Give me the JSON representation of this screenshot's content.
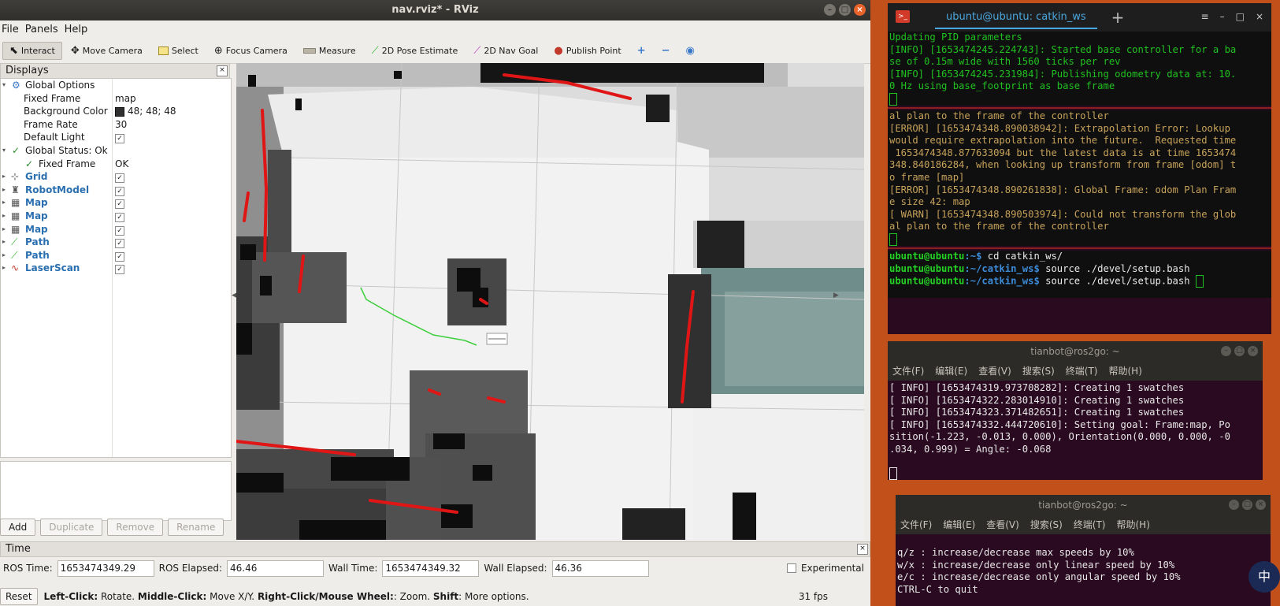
{
  "rviz": {
    "title": "nav.rviz* - RViz",
    "menus": [
      "File",
      "Panels",
      "Help"
    ],
    "tools": [
      {
        "label": "Interact",
        "icon": "cursor-icon",
        "active": true
      },
      {
        "label": "Move Camera",
        "icon": "move-camera-icon"
      },
      {
        "label": "Select",
        "icon": "select-icon"
      },
      {
        "label": "Focus Camera",
        "icon": "focus-camera-icon"
      },
      {
        "label": "Measure",
        "icon": "ruler-icon"
      },
      {
        "label": "2D Pose Estimate",
        "icon": "pose-arrow-green-icon"
      },
      {
        "label": "2D Nav Goal",
        "icon": "nav-goal-arrow-magenta-icon"
      },
      {
        "label": "Publish Point",
        "icon": "map-pin-icon"
      }
    ],
    "displays": {
      "title": "Displays",
      "global_options": "Global Options",
      "fixed_frame_label": "Fixed Frame",
      "fixed_frame_value": "map",
      "background_color_label": "Background Color",
      "background_color_value": "48; 48; 48",
      "frame_rate_label": "Frame Rate",
      "frame_rate_value": "30",
      "default_light_label": "Default Light",
      "global_status": "Global Status: Ok",
      "status_fixed_frame": "Fixed Frame",
      "status_fixed_frame_value": "OK",
      "items": [
        "Grid",
        "RobotModel",
        "Map",
        "Map",
        "Map",
        "Path",
        "Path",
        "LaserScan"
      ],
      "buttons": {
        "add": "Add",
        "duplicate": "Duplicate",
        "remove": "Remove",
        "rename": "Rename"
      }
    },
    "time": {
      "title": "Time",
      "ros_time_label": "ROS Time:",
      "ros_time": "1653474349.29",
      "ros_elapsed_label": "ROS Elapsed:",
      "ros_elapsed": "46.46",
      "wall_time_label": "Wall Time:",
      "wall_time": "1653474349.32",
      "wall_elapsed_label": "Wall Elapsed:",
      "wall_elapsed": "46.36",
      "experimental": "Experimental"
    },
    "status": {
      "reset": "Reset",
      "left_click": "Left-Click:",
      "rotate": " Rotate. ",
      "middle_click": "Middle-Click:",
      "move": " Move X/Y. ",
      "right_click": "Right-Click/Mouse Wheel:",
      "zoom": ": Zoom. ",
      "shift": "Shift",
      "more": ": More options.",
      "fps": "31 fps"
    }
  },
  "terminal1": {
    "tab_title": "ubuntu@ubuntu: catkin_ws",
    "block1": [
      "Updating PID parameters",
      "[INFO] [1653474245.224743]: Started base controller for a ba",
      "se of 0.15m wide with 1560 ticks per rev",
      "[INFO] [1653474245.231984]: Publishing odometry data at: 10.",
      "0 Hz using base_footprint as base frame"
    ],
    "block2": [
      "al plan to the frame of the controller",
      "[ERROR] [1653474348.890038942]: Extrapolation Error: Lookup",
      "would require extrapolation into the future.  Requested time",
      " 1653474348.877633094 but the latest data is at time 1653474",
      "348.840186284, when looking up transform from frame [odom] t",
      "o frame [map]",
      "",
      "[ERROR] [1653474348.890261838]: Global Frame: odom Plan Fram",
      "e size 42: map",
      "",
      "[ WARN] [1653474348.890503974]: Could not transform the glob",
      "al plan to the frame of the controller"
    ],
    "prompt_user": "ubuntu@ubuntu",
    "cmd1_path": ":~$",
    "cmd1": " cd catkin_ws/",
    "cmd2_path": ":~/catkin_ws$",
    "cmd2": " source ./devel/setup.bash",
    "cmd3_path": ":~/catkin_ws$",
    "cmd3": " source ./devel/setup.bash"
  },
  "terminal2": {
    "title": "tianbot@ros2go: ~",
    "menu": [
      "文件(F)",
      "编辑(E)",
      "查看(V)",
      "搜索(S)",
      "终端(T)",
      "帮助(H)"
    ],
    "lines": [
      "[ INFO] [1653474319.973708282]: Creating 1 swatches",
      "[ INFO] [1653474322.283014910]: Creating 1 swatches",
      "[ INFO] [1653474323.371482651]: Creating 1 swatches",
      "[ INFO] [1653474332.444720610]: Setting goal: Frame:map, Po",
      "sition(-1.223, -0.013, 0.000), Orientation(0.000, 0.000, -0",
      ".034, 0.999) = Angle: -0.068"
    ]
  },
  "terminal3": {
    "title": "tianbot@ros2go: ~",
    "menu": [
      "文件(F)",
      "编辑(E)",
      "查看(V)",
      "搜索(S)",
      "终端(T)",
      "帮助(H)"
    ],
    "lines": [
      "q/z : increase/decrease max speeds by 10%",
      "w/x : increase/decrease only linear speed by 10%",
      "e/c : increase/decrease only angular speed by 10%",
      "",
      "CTRL-C to quit"
    ]
  },
  "tray_char": "中"
}
